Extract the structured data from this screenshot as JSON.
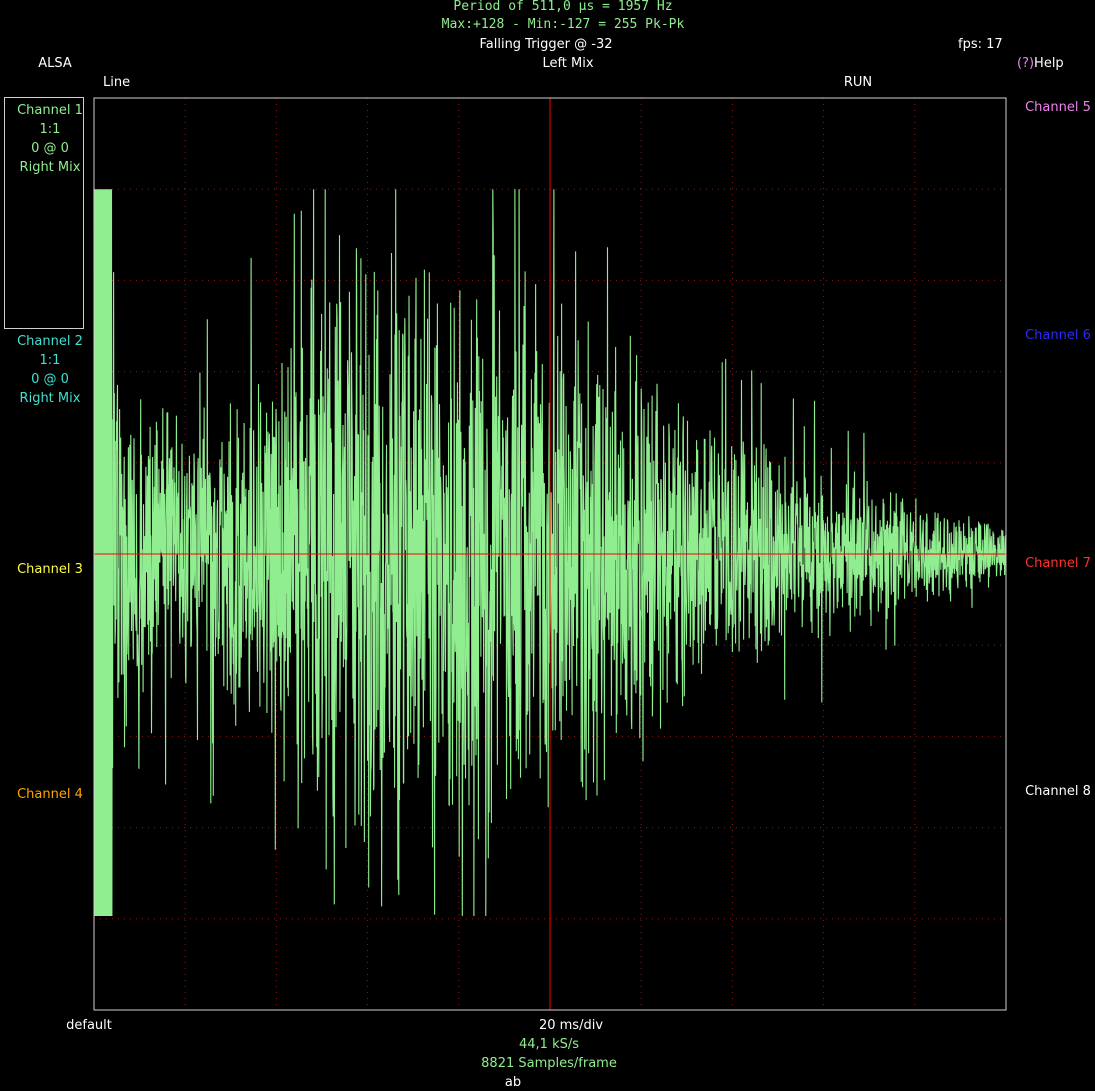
{
  "header": {
    "period": "Period of 511,0 µs =  1957 Hz",
    "maxmin": "Max:+128 - Min:-127 = 255 Pk-Pk",
    "trigger": "Falling Trigger @ -32",
    "fps": "fps: 17",
    "source": "ALSA",
    "channel_mix": "Left Mix",
    "help_mark": "(?)",
    "help_label": "Help",
    "input": "Line",
    "run_state": "RUN"
  },
  "channels_left": [
    {
      "name": "Channel 1",
      "scale": "1:1",
      "offset": "0 @ 0",
      "mix": "Right Mix",
      "color": "#90ee90"
    },
    {
      "name": "Channel 2",
      "scale": "1:1",
      "offset": "0 @ 0",
      "mix": "Right Mix",
      "color": "#40e0d0"
    },
    {
      "name": "Channel 3",
      "color": "#ffff40"
    },
    {
      "name": "Channel 4",
      "color": "#ffa500"
    }
  ],
  "channels_right": [
    {
      "name": "Channel 5",
      "color": "#ee82ee"
    },
    {
      "name": "Channel 6",
      "color": "#0000ff"
    },
    {
      "name": "Channel 7",
      "color": "#ff3030"
    },
    {
      "name": "Channel 8",
      "color": "#ffffff"
    }
  ],
  "footer": {
    "preset": "default",
    "timebase": "20 ms/div",
    "sample_rate": "44,1 kS/s",
    "samples": "8821 Samples/frame",
    "hint": "ab"
  },
  "colors": {
    "trace": "#90ee90",
    "trigger": "#ff0000",
    "grid": "#8a1c1c",
    "border": "#d0d0d0",
    "text_accent": "#90ee90"
  },
  "chart_data": {
    "type": "line",
    "x_divisions": 10,
    "y_divisions": 10,
    "timebase_ms_per_div": 20,
    "grid": true,
    "trigger_level": -32,
    "y_range": [
      -128,
      128
    ],
    "envelope": [
      {
        "t": 0.0,
        "a": 128
      },
      {
        "t": 0.02,
        "a": 128
      },
      {
        "t": 0.03,
        "a": 75
      },
      {
        "t": 0.1,
        "a": 55
      },
      {
        "t": 0.2,
        "a": 75
      },
      {
        "t": 0.25,
        "a": 125
      },
      {
        "t": 0.32,
        "a": 128
      },
      {
        "t": 0.38,
        "a": 118
      },
      {
        "t": 0.45,
        "a": 115
      },
      {
        "t": 0.5,
        "a": 95
      },
      {
        "t": 0.55,
        "a": 100
      },
      {
        "t": 0.6,
        "a": 75
      },
      {
        "t": 0.7,
        "a": 45
      },
      {
        "t": 0.8,
        "a": 35
      },
      {
        "t": 0.9,
        "a": 22
      },
      {
        "t": 1.0,
        "a": 12
      }
    ]
  }
}
